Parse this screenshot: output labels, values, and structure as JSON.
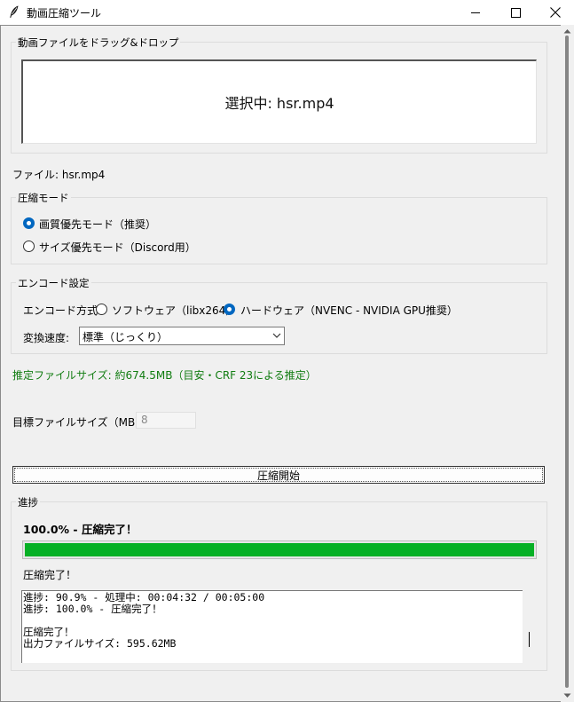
{
  "window": {
    "title": "動画圧縮ツール",
    "icon": "feather-icon"
  },
  "drop": {
    "group_label": "動画ファイルをドラッグ&ドロップ",
    "selected_text": "選択中: hsr.mp4"
  },
  "file_label": "ファイル: hsr.mp4",
  "mode": {
    "group_label": "圧縮モード",
    "options": [
      {
        "label": "画質優先モード（推奨）",
        "checked": true
      },
      {
        "label": "サイズ優先モード（Discord用）",
        "checked": false
      }
    ]
  },
  "encode": {
    "group_label": "エンコード設定",
    "method_label": "エンコード方式:",
    "methods": [
      {
        "label": "ソフトウェア（libx264）",
        "checked": false
      },
      {
        "label": "ハードウェア（NVENC - NVIDIA GPU推奨）",
        "checked": true
      }
    ],
    "speed_label": "変換速度:",
    "speed_value": "標準（じっくり）"
  },
  "estimate": {
    "text": "推定ファイルサイズ: 約674.5MB（目安・CRF 23による推定）",
    "color": "#107c10"
  },
  "target": {
    "label": "目標ファイルサイズ（MB）:",
    "value": "8"
  },
  "start_button": "圧縮開始",
  "progress": {
    "group_label": "進捗",
    "headline": "100.0% - 圧縮完了！",
    "fraction": 1.0,
    "bar_color": "#06b025",
    "status": "圧縮完了！",
    "log": [
      "進捗: 90.9% - 処理中: 00:04:32 / 00:05:00",
      "進捗: 100.0% - 圧縮完了！",
      "",
      "圧縮完了！",
      "出力ファイルサイズ: 595.62MB"
    ]
  }
}
